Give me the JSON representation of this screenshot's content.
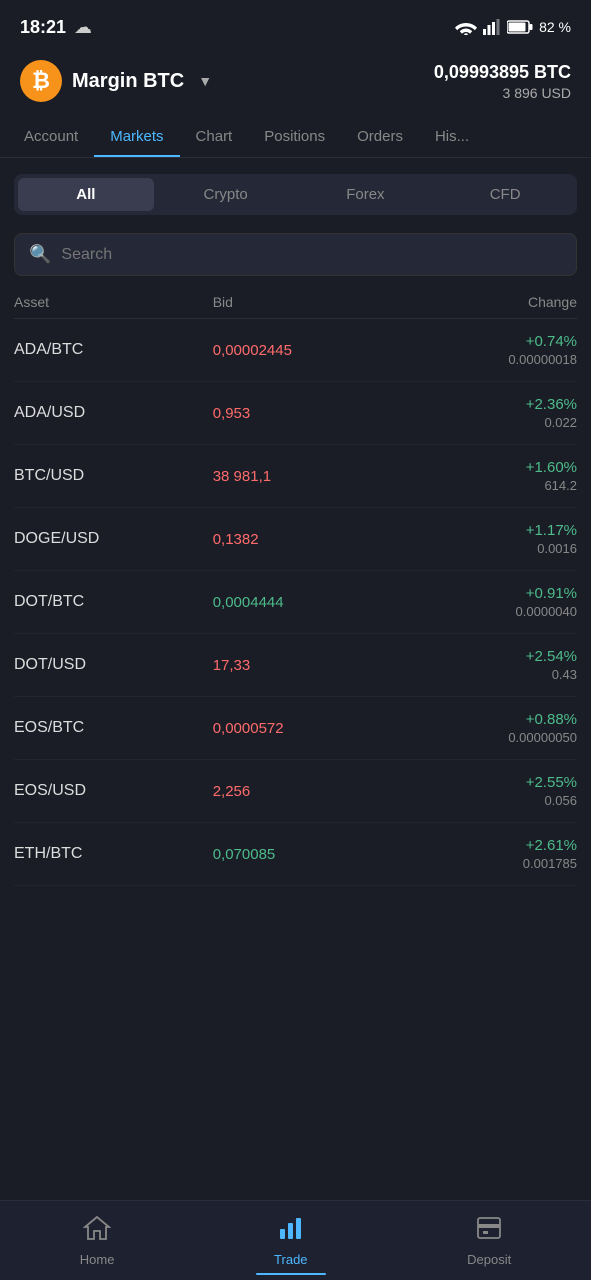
{
  "statusBar": {
    "time": "18:21",
    "battery": "82 %"
  },
  "header": {
    "accountLabel": "Margin BTC",
    "dropdownIcon": "▼",
    "balanceBTC": "0,09993895 BTC",
    "balanceUSD": "3 896 USD"
  },
  "navTabs": {
    "items": [
      {
        "id": "account",
        "label": "Account",
        "active": false
      },
      {
        "id": "markets",
        "label": "Markets",
        "active": true
      },
      {
        "id": "chart",
        "label": "Chart",
        "active": false
      },
      {
        "id": "positions",
        "label": "Positions",
        "active": false
      },
      {
        "id": "orders",
        "label": "Orders",
        "active": false
      },
      {
        "id": "history",
        "label": "His...",
        "active": false
      }
    ]
  },
  "filterButtons": {
    "items": [
      {
        "id": "all",
        "label": "All",
        "active": true
      },
      {
        "id": "crypto",
        "label": "Crypto",
        "active": false
      },
      {
        "id": "forex",
        "label": "Forex",
        "active": false
      },
      {
        "id": "cfd",
        "label": "CFD",
        "active": false
      }
    ]
  },
  "search": {
    "placeholder": "Search"
  },
  "tableHeaders": {
    "asset": "Asset",
    "bid": "Bid",
    "change": "Change"
  },
  "tableRows": [
    {
      "asset": "ADA/BTC",
      "bid": "0,00002445",
      "bidColor": "red",
      "changePct": "+0.74%",
      "changeVal": "0.00000018"
    },
    {
      "asset": "ADA/USD",
      "bid": "0,953",
      "bidColor": "red",
      "changePct": "+2.36%",
      "changeVal": "0.022"
    },
    {
      "asset": "BTC/USD",
      "bid": "38 981,1",
      "bidColor": "red",
      "changePct": "+1.60%",
      "changeVal": "614.2"
    },
    {
      "asset": "DOGE/USD",
      "bid": "0,1382",
      "bidColor": "red",
      "changePct": "+1.17%",
      "changeVal": "0.0016"
    },
    {
      "asset": "DOT/BTC",
      "bid": "0,0004444",
      "bidColor": "green",
      "changePct": "+0.91%",
      "changeVal": "0.0000040"
    },
    {
      "asset": "DOT/USD",
      "bid": "17,33",
      "bidColor": "red",
      "changePct": "+2.54%",
      "changeVal": "0.43"
    },
    {
      "asset": "EOS/BTC",
      "bid": "0,0000572",
      "bidColor": "red",
      "changePct": "+0.88%",
      "changeVal": "0.00000050"
    },
    {
      "asset": "EOS/USD",
      "bid": "2,256",
      "bidColor": "red",
      "changePct": "+2.55%",
      "changeVal": "0.056"
    },
    {
      "asset": "ETH/BTC",
      "bid": "0,070085",
      "bidColor": "green",
      "changePct": "+2.61%",
      "changeVal": "0.001785"
    }
  ],
  "bottomNav": {
    "items": [
      {
        "id": "home",
        "label": "Home",
        "active": false,
        "icon": "home"
      },
      {
        "id": "trade",
        "label": "Trade",
        "active": true,
        "icon": "chart"
      },
      {
        "id": "deposit",
        "label": "Deposit",
        "active": false,
        "icon": "deposit"
      }
    ]
  }
}
